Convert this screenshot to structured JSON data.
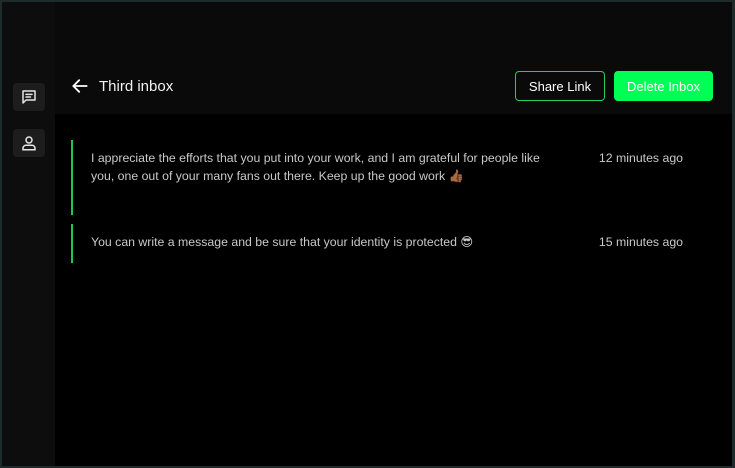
{
  "sidebar": {
    "items": [
      {
        "icon": "messages-icon"
      },
      {
        "icon": "user-icon"
      }
    ]
  },
  "header": {
    "back_icon": "arrow-left-icon",
    "title": "Third inbox",
    "share_label": "Share Link",
    "delete_label": "Delete Inbox"
  },
  "colors": {
    "accent": "#00ff55",
    "accent_border": "#20d158",
    "message_bar": "#19c94e",
    "background": "#000000",
    "text": "#c9c9c9"
  },
  "messages": [
    {
      "text": "I appreciate the efforts that you put into your work, and I am grateful for people like you, one out of your many fans out there. Keep up the good work 👍🏾",
      "time": "12 minutes ago"
    },
    {
      "text": "You can write a message and be sure that your identity is protected 😎",
      "time": "15 minutes ago"
    }
  ]
}
